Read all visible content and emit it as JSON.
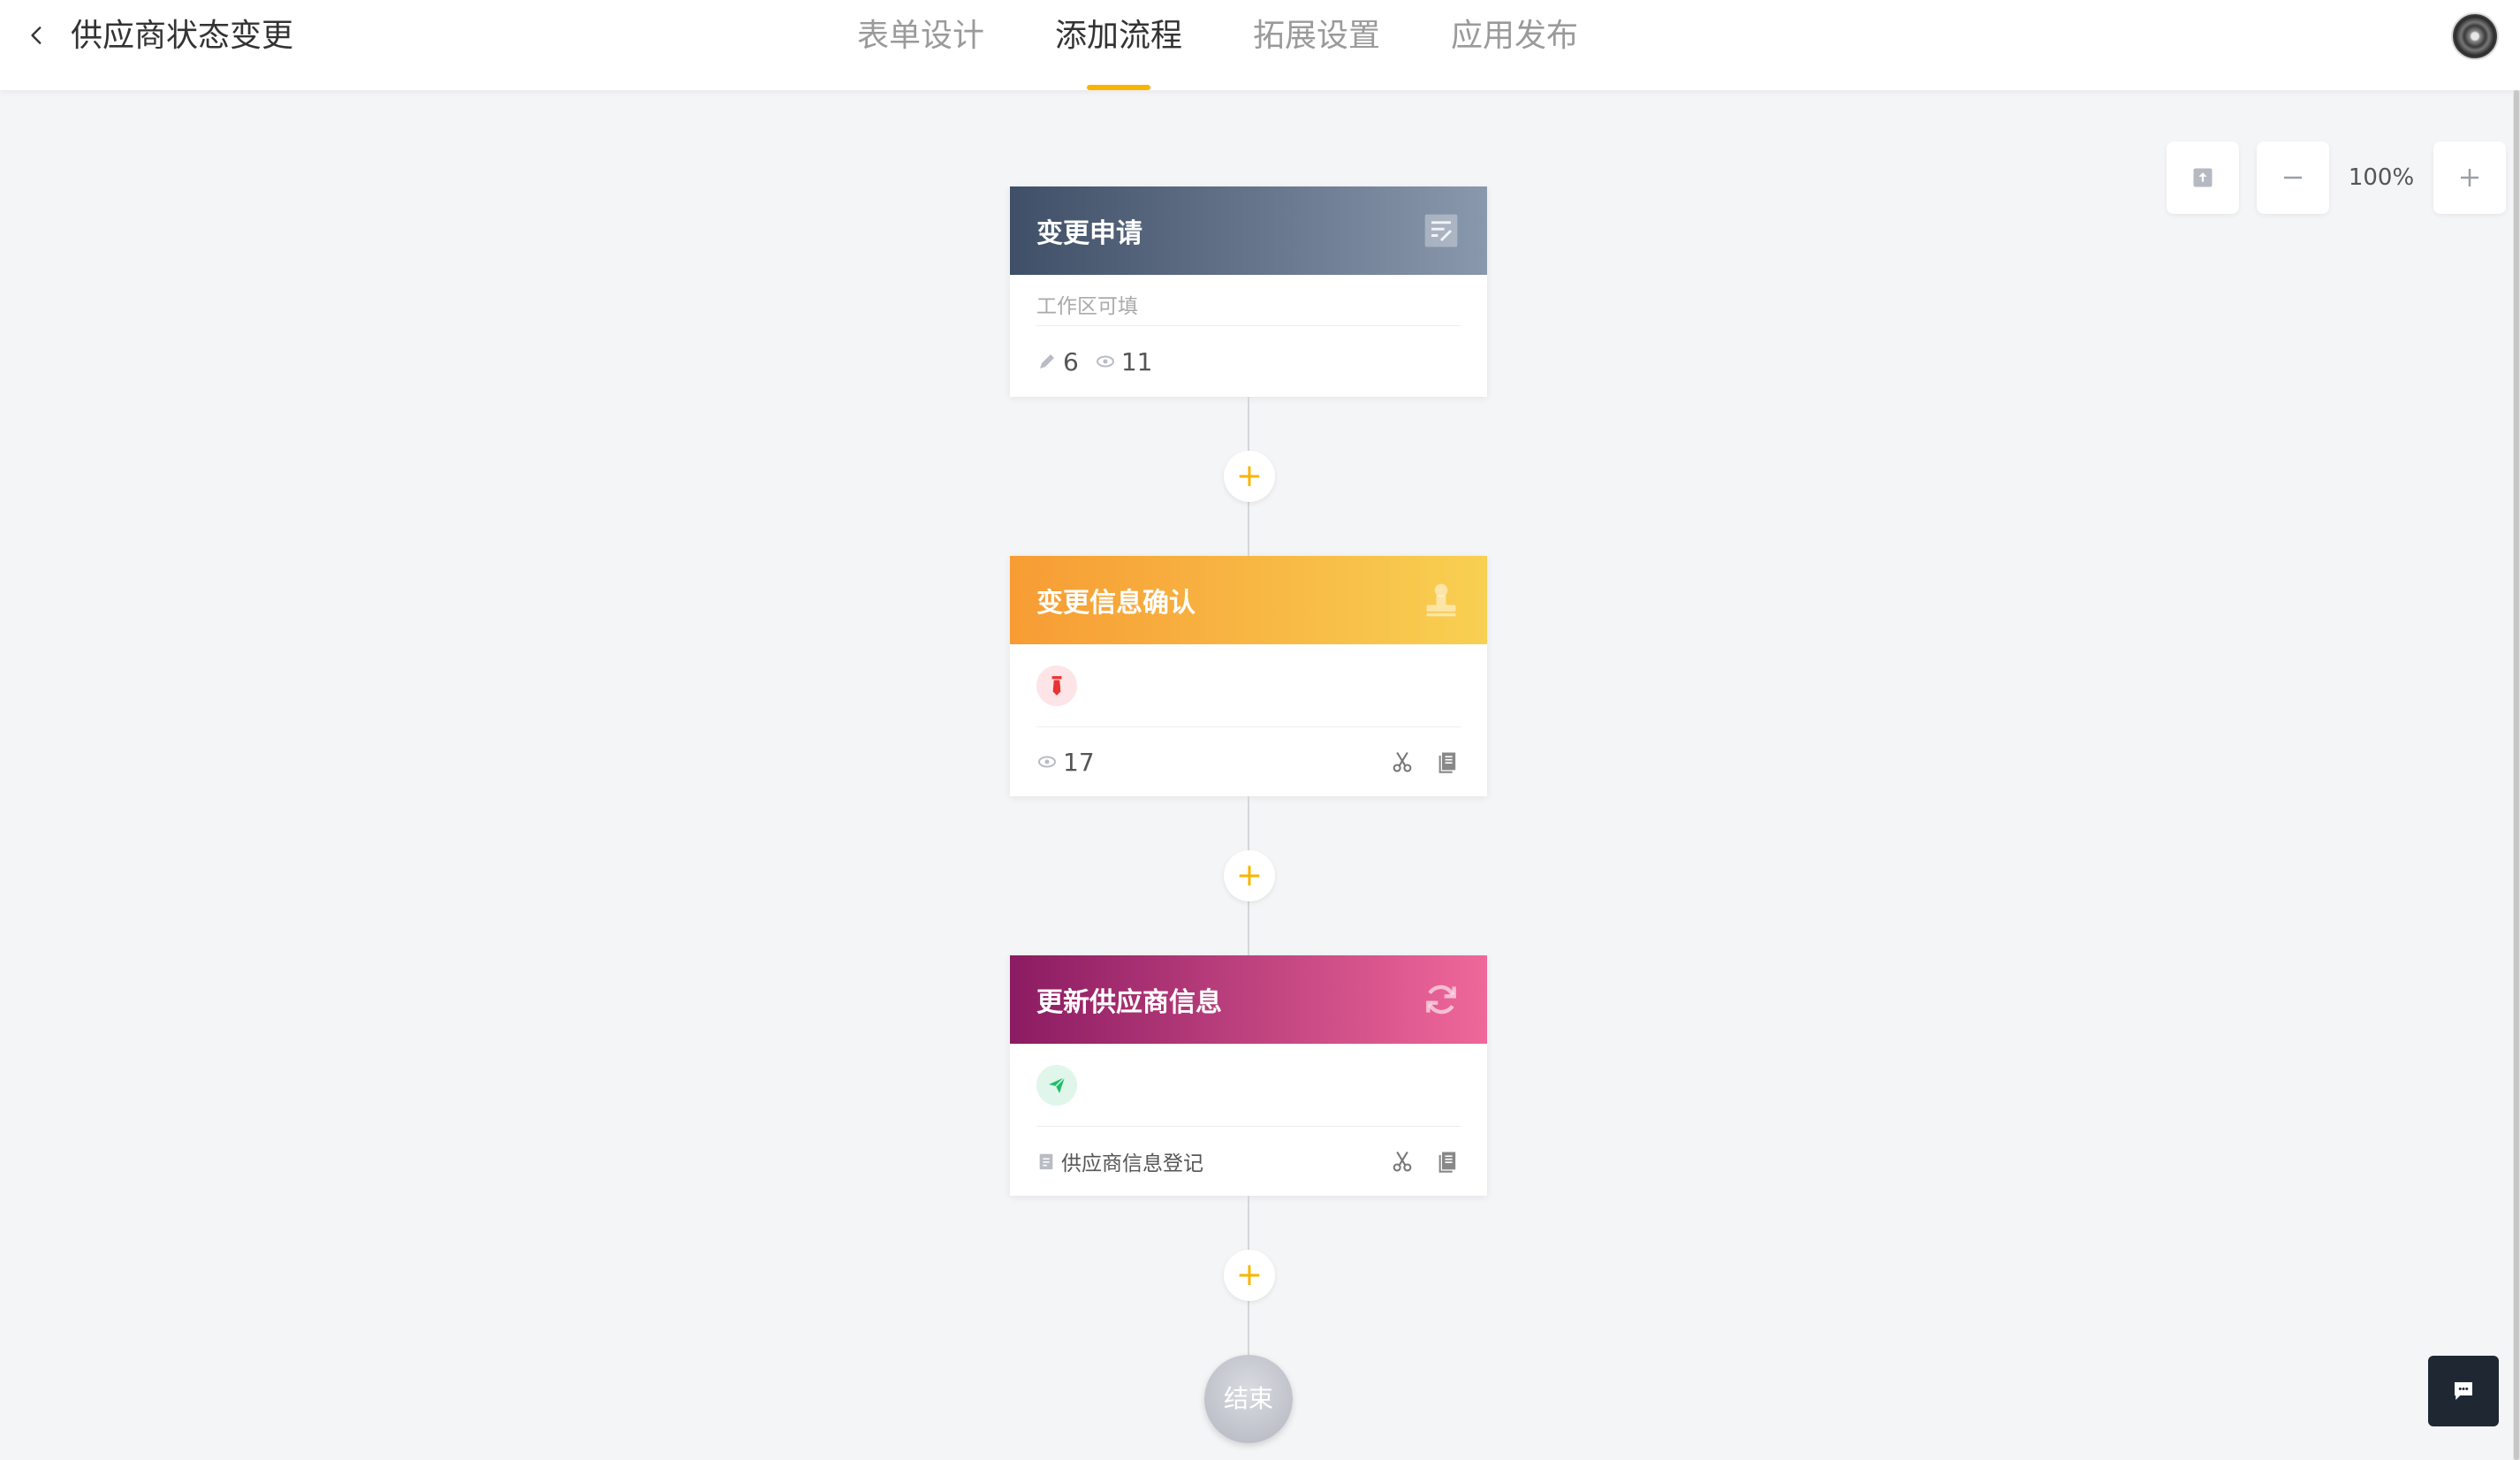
{
  "header": {
    "title": "供应商状态变更",
    "tabs": [
      {
        "label": "表单设计",
        "active": false
      },
      {
        "label": "添加流程",
        "active": true
      },
      {
        "label": "拓展设置",
        "active": false
      },
      {
        "label": "应用发布",
        "active": false
      }
    ]
  },
  "zoom": {
    "level": "100%"
  },
  "colors": {
    "accent": "#f7b500"
  },
  "nodes": [
    {
      "title": "变更申请",
      "icon": "form-edit-icon",
      "hint": "工作区可填",
      "edit_count": "6",
      "view_count": "11"
    },
    {
      "title": "变更信息确认",
      "icon": "stamp-icon",
      "assignee_icon": "red-tie-person-icon",
      "view_count": "17"
    },
    {
      "title": "更新供应商信息",
      "icon": "refresh-icon",
      "assignee_icon": "paper-plane-icon",
      "form_name": "供应商信息登记"
    }
  ],
  "end": {
    "label": "结束"
  },
  "add_label": "+"
}
